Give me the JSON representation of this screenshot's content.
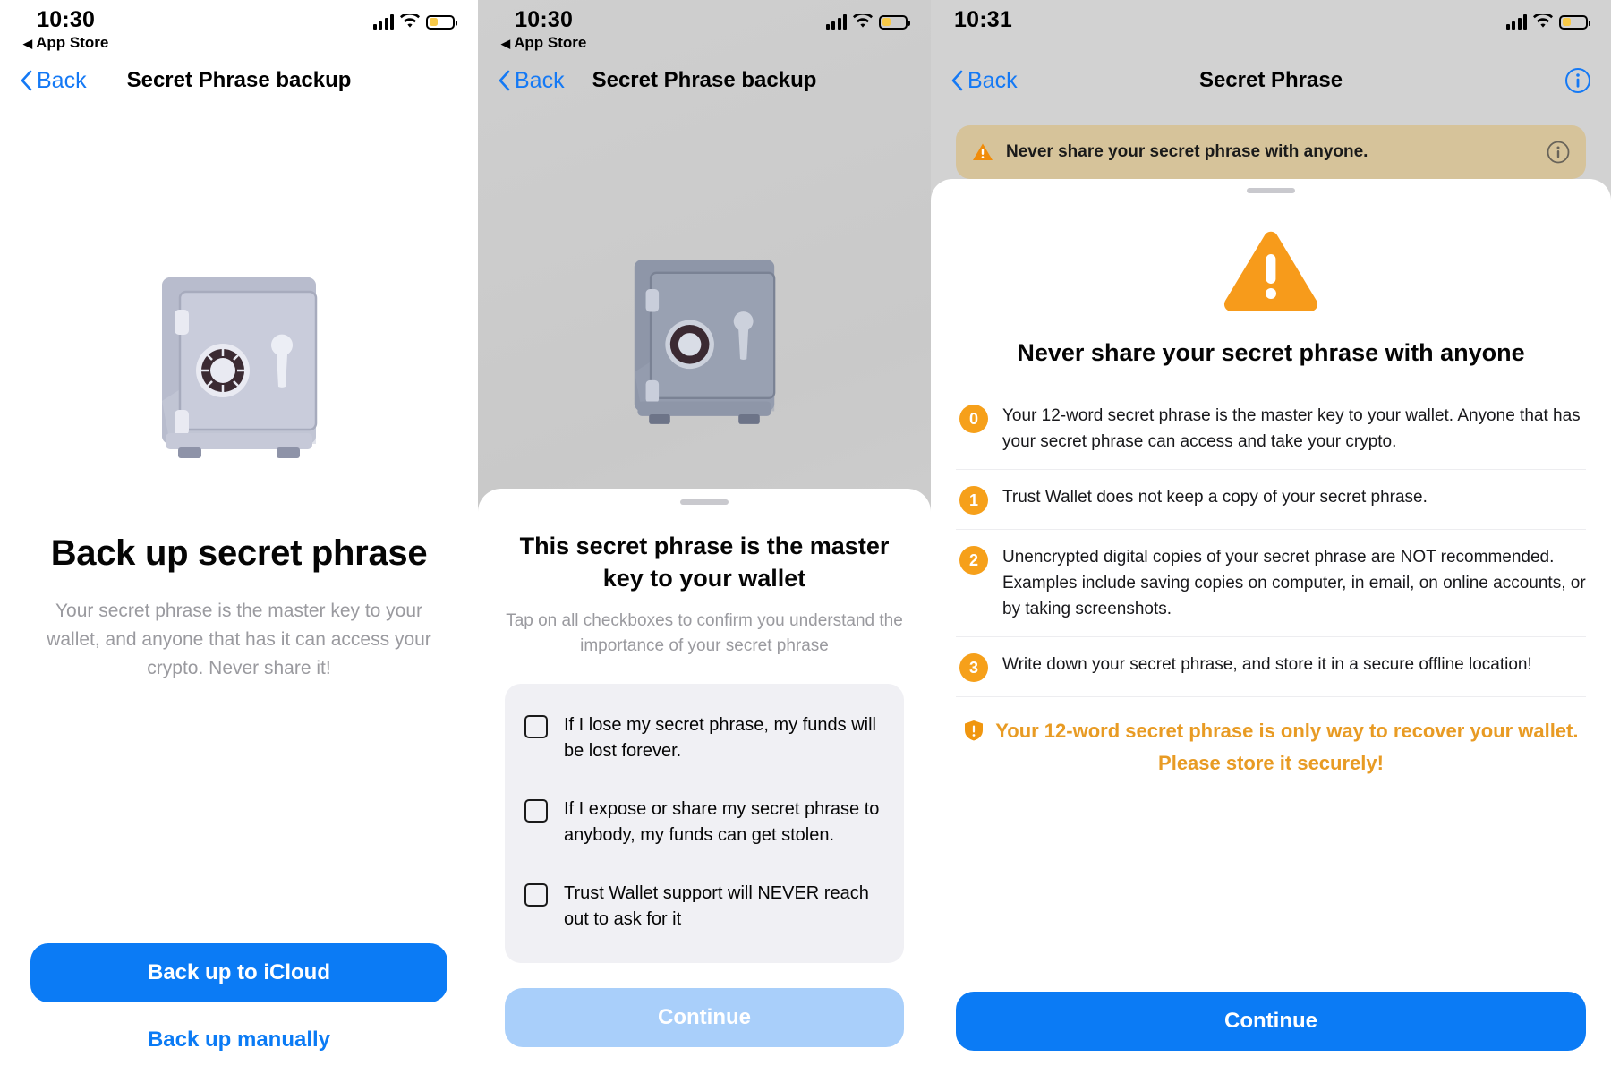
{
  "panel1": {
    "status": {
      "time": "10:30",
      "return_app": "App Store",
      "return_prefix": "◀"
    },
    "nav": {
      "back": "Back",
      "title": "Secret Phrase backup"
    },
    "heading": "Back up secret phrase",
    "description": "Your secret phrase is the master key to your wallet, and anyone that has it can access your crypto. Never share it!",
    "primary_button": "Back up to iCloud",
    "secondary_link": "Back up manually"
  },
  "panel2": {
    "status": {
      "time": "10:30",
      "return_app": "App Store",
      "return_prefix": "◀"
    },
    "nav": {
      "back": "Back",
      "title": "Secret Phrase backup"
    },
    "sheet": {
      "title": "This secret phrase is the master key to your wallet",
      "subtitle": "Tap on all checkboxes to confirm you understand the importance of your secret phrase",
      "checkboxes": [
        {
          "label": "If I lose my secret phrase, my funds will be lost forever.",
          "checked": false
        },
        {
          "label": "If I expose or share my secret phrase to anybody, my funds can get stolen.",
          "checked": false
        },
        {
          "label": "Trust Wallet support will NEVER reach out to ask for it",
          "checked": false
        }
      ],
      "continue_button": "Continue",
      "continue_enabled": false
    }
  },
  "panel3": {
    "status": {
      "time": "10:31"
    },
    "nav": {
      "back": "Back",
      "title": "Secret Phrase"
    },
    "banner": {
      "text": "Never share your secret phrase with anyone."
    },
    "modal": {
      "title": "Never share your secret phrase with anyone",
      "items": [
        {
          "number": "0",
          "text": "Your 12-word secret phrase is the master key to your wallet. Anyone that has your secret phrase can access and take your crypto."
        },
        {
          "number": "1",
          "text": "Trust Wallet does not keep a copy of your secret phrase."
        },
        {
          "number": "2",
          "text": "Unencrypted digital copies of your secret phrase are NOT recommended. Examples include saving copies on computer, in email, on online accounts, or by taking screenshots."
        },
        {
          "number": "3",
          "text": "Write down your secret phrase, and store it in a secure offline location!"
        }
      ],
      "final_warning": "Your 12-word secret phrase is only way to recover your wallet. Please store it securely!",
      "continue_button": "Continue"
    }
  },
  "colors": {
    "accent_blue": "#0B7BF5",
    "link_blue": "#1479F5",
    "warning_orange": "#F6A01A",
    "warning_text": "#E89B24",
    "disabled_blue": "#A9CFFA",
    "battery_yellow": "#F7C948"
  }
}
